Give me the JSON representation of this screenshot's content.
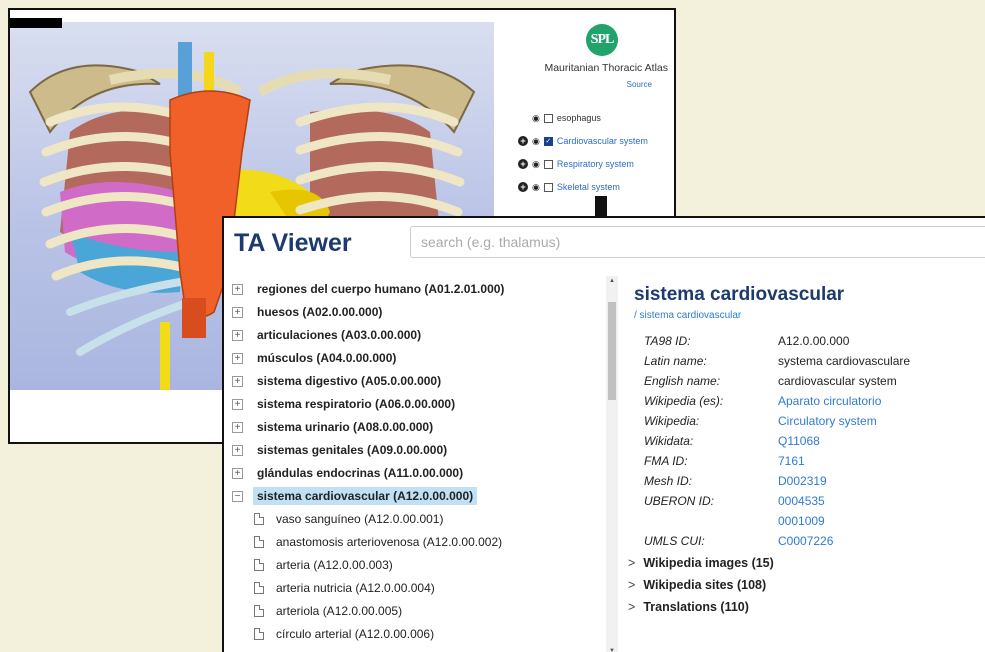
{
  "atlas": {
    "logo_text": "SPL",
    "title": "Mauritanian Thoracic Atlas",
    "source_label": "Source",
    "layers": [
      {
        "label": "esophagus",
        "checked": false,
        "expandable": false
      },
      {
        "label": "Cardiovascular system",
        "checked": true,
        "expandable": true
      },
      {
        "label": "Respiratory system",
        "checked": false,
        "expandable": true
      },
      {
        "label": "Skeletal system",
        "checked": false,
        "expandable": true
      }
    ]
  },
  "viewer": {
    "logo": "TA Viewer",
    "search_placeholder": "search (e.g. thalamus)",
    "tree": [
      {
        "label": "regiones del cuerpo humano (A01.2.01.000)",
        "toggle": "+"
      },
      {
        "label": "huesos (A02.0.00.000)",
        "toggle": "+"
      },
      {
        "label": "articulaciones (A03.0.00.000)",
        "toggle": "+"
      },
      {
        "label": "músculos (A04.0.00.000)",
        "toggle": "+"
      },
      {
        "label": "sistema digestivo (A05.0.00.000)",
        "toggle": "+"
      },
      {
        "label": "sistema respiratorio (A06.0.00.000)",
        "toggle": "+"
      },
      {
        "label": "sistema urinario (A08.0.00.000)",
        "toggle": "+"
      },
      {
        "label": "sistemas genitales (A09.0.00.000)",
        "toggle": "+"
      },
      {
        "label": "glándulas endocrinas (A11.0.00.000)",
        "toggle": "+"
      },
      {
        "label": "sistema cardiovascular (A12.0.00.000)",
        "toggle": "−"
      }
    ],
    "children": [
      "vaso sanguíneo (A12.0.00.001)",
      "anastomosis arteriovenosa (A12.0.00.002)",
      "arteria (A12.0.00.003)",
      "arteria nutricia (A12.0.00.004)",
      "arteriola (A12.0.00.005)",
      "círculo arterial (A12.0.00.006)"
    ],
    "detail": {
      "title": "sistema cardiovascular",
      "breadcrumb": "/ sistema cardiovascular",
      "fields": [
        {
          "key": "TA98 ID:",
          "value": "A12.0.00.000",
          "link": false
        },
        {
          "key": "Latin name:",
          "value": "systema cardiovasculare",
          "link": false
        },
        {
          "key": "English name:",
          "value": "cardiovascular system",
          "link": false
        },
        {
          "key": "Wikipedia (es):",
          "value": "Aparato circulatorio",
          "link": true
        },
        {
          "key": "Wikipedia:",
          "value": "Circulatory system",
          "link": true
        },
        {
          "key": "Wikidata:",
          "value": "Q11068",
          "link": true
        },
        {
          "key": "FMA ID:",
          "value": "7161",
          "link": true
        },
        {
          "key": "Mesh ID:",
          "value": "D002319",
          "link": true
        },
        {
          "key": "UBERON ID:",
          "value": "0004535",
          "link": true
        },
        {
          "key": "",
          "value": "0001009",
          "link": true
        },
        {
          "key": "UMLS CUI:",
          "value": "C0007226",
          "link": true
        }
      ],
      "sections": [
        {
          "chevron": ">",
          "label": "Wikipedia images (15)"
        },
        {
          "chevron": ">",
          "label": "Wikipedia sites (108)"
        },
        {
          "chevron": ">",
          "label": "Translations (110)"
        }
      ]
    }
  },
  "colors": {
    "page_bg": "#f3f0dc",
    "title_blue": "#1c3a6e",
    "link_blue": "#2d7bd4",
    "selected_bg": "#bfe0f5",
    "spl_green": "#21a36b"
  }
}
